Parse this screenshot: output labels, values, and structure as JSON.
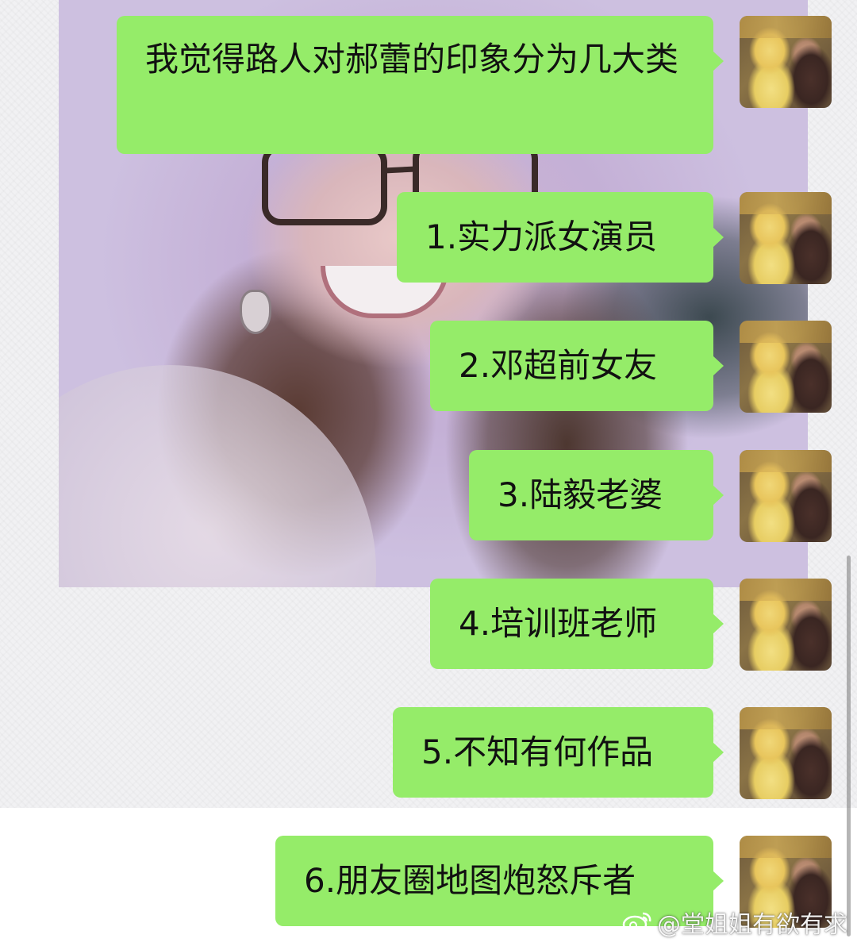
{
  "messages": [
    {
      "text": "我觉得路人对郝蕾的印象分为几大类"
    },
    {
      "text": "1.实力派女演员"
    },
    {
      "text": "2.邓超前女友"
    },
    {
      "text": "3.陆毅老婆"
    },
    {
      "text": "4.培训班老师"
    },
    {
      "text": "5.不知有何作品"
    },
    {
      "text": "6.朋友圈地图炮怒斥者"
    }
  ],
  "watermark": {
    "text": "@堂姐姐有欲有求",
    "icon": "weibo-logo-icon"
  },
  "colors": {
    "bubble": "#95ec69",
    "text": "#111111",
    "background": "#f1f1f3"
  }
}
